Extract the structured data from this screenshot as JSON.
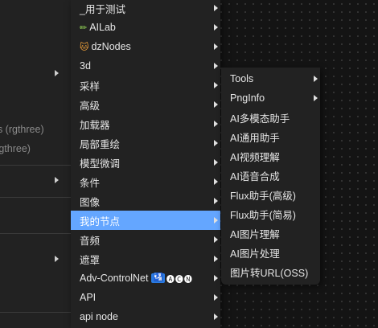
{
  "parent_menu": {
    "texts": [
      "es (rgthree)",
      "(rgthree)"
    ]
  },
  "main_menu": {
    "items": [
      {
        "label": "_用于测试",
        "icon": "",
        "submenu": true,
        "active": false
      },
      {
        "label": "AILab",
        "icon": "pencil-icon",
        "submenu": true,
        "active": false
      },
      {
        "label": "dzNodes",
        "icon": "cat-face-icon",
        "submenu": true,
        "active": false
      },
      {
        "label": "3d",
        "icon": "",
        "submenu": true,
        "active": false
      },
      {
        "label": "采样",
        "icon": "",
        "submenu": true,
        "active": false
      },
      {
        "label": "高级",
        "icon": "",
        "submenu": true,
        "active": false
      },
      {
        "label": "加载器",
        "icon": "",
        "submenu": true,
        "active": false
      },
      {
        "label": "局部重绘",
        "icon": "",
        "submenu": true,
        "active": false
      },
      {
        "label": "模型微调",
        "icon": "",
        "submenu": true,
        "active": false
      },
      {
        "label": "条件",
        "icon": "",
        "submenu": true,
        "active": false
      },
      {
        "label": "图像",
        "icon": "",
        "submenu": true,
        "active": false
      },
      {
        "label": "我的节点",
        "icon": "",
        "submenu": true,
        "active": true
      },
      {
        "label": "音频",
        "icon": "",
        "submenu": true,
        "active": false
      },
      {
        "label": "遮罩",
        "icon": "",
        "submenu": true,
        "active": false
      },
      {
        "label": "Adv-ControlNet",
        "icon": "",
        "badge": "🛂",
        "mini": "🅐🅒🅝",
        "submenu": true,
        "active": false
      },
      {
        "label": "API",
        "icon": "",
        "submenu": true,
        "active": false
      },
      {
        "label": "api node",
        "icon": "",
        "submenu": true,
        "active": false
      }
    ]
  },
  "sub_menu": {
    "items": [
      {
        "label": "Tools",
        "submenu": true
      },
      {
        "label": "PngInfo",
        "submenu": true
      },
      {
        "label": "AI多模态助手",
        "submenu": false
      },
      {
        "label": "AI通用助手",
        "submenu": false
      },
      {
        "label": "AI视频理解",
        "submenu": false
      },
      {
        "label": "AI语音合成",
        "submenu": false
      },
      {
        "label": "Flux助手(高级)",
        "submenu": false
      },
      {
        "label": "Flux助手(简易)",
        "submenu": false
      },
      {
        "label": "AI图片理解",
        "submenu": false
      },
      {
        "label": "AI图片处理",
        "submenu": false
      },
      {
        "label": "图片转URL(OSS)",
        "submenu": false
      }
    ]
  },
  "colors": {
    "highlight": "#64a6ff",
    "menu_bg": "#222222",
    "canvas_bg": "#141414"
  }
}
